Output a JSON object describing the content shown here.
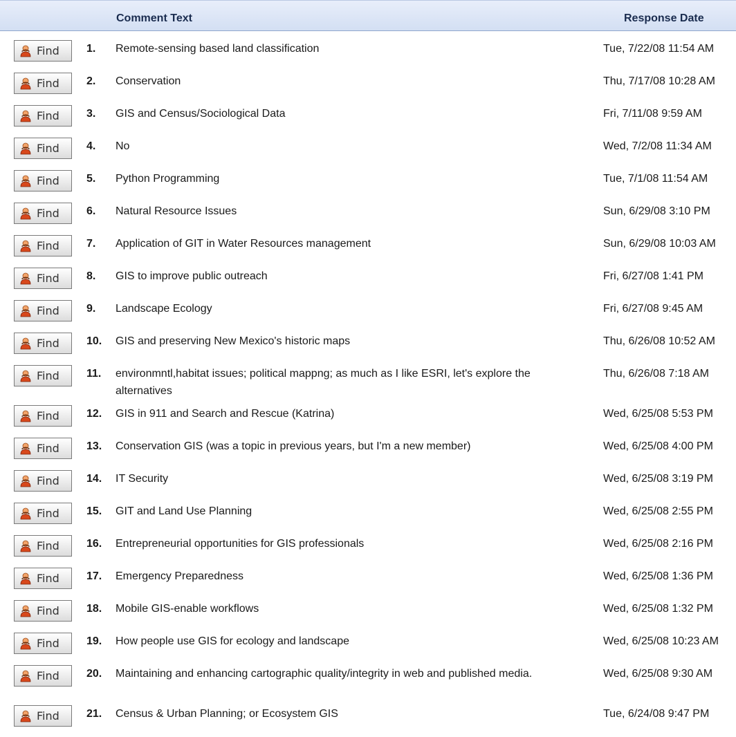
{
  "header": {
    "comment_col": "Comment Text",
    "date_col": "Response Date"
  },
  "find_label": "Find",
  "button_icon": "person-icon",
  "rows": [
    {
      "num": "1.",
      "text": "Remote-sensing based land classification",
      "date": "Tue, 7/22/08 11:54 AM"
    },
    {
      "num": "2.",
      "text": "Conservation",
      "date": "Thu, 7/17/08 10:28 AM"
    },
    {
      "num": "3.",
      "text": "GIS and Census/Sociological Data",
      "date": "Fri, 7/11/08 9:59 AM"
    },
    {
      "num": "4.",
      "text": "No",
      "date": "Wed, 7/2/08 11:34 AM"
    },
    {
      "num": "5.",
      "text": "Python Programming",
      "date": "Tue, 7/1/08 11:54 AM"
    },
    {
      "num": "6.",
      "text": "Natural Resource Issues",
      "date": "Sun, 6/29/08 3:10 PM"
    },
    {
      "num": "7.",
      "text": "Application of GIT in Water Resources management",
      "date": "Sun, 6/29/08 10:03 AM"
    },
    {
      "num": "8.",
      "text": "GIS to improve public outreach",
      "date": "Fri, 6/27/08 1:41 PM"
    },
    {
      "num": "9.",
      "text": "Landscape Ecology",
      "date": "Fri, 6/27/08 9:45 AM"
    },
    {
      "num": "10.",
      "text": "GIS and preserving New Mexico's historic maps",
      "date": "Thu, 6/26/08 10:52 AM"
    },
    {
      "num": "11.",
      "text": "environmntl,habitat issues; political mappng; as much as I like ESRI, let's explore the alternatives",
      "date": "Thu, 6/26/08 7:18 AM"
    },
    {
      "num": "12.",
      "text": "GIS in 911 and Search and Rescue (Katrina)",
      "date": "Wed, 6/25/08 5:53 PM"
    },
    {
      "num": "13.",
      "text": "Conservation GIS (was a topic in previous years, but I'm a new member)",
      "date": "Wed, 6/25/08 4:00 PM"
    },
    {
      "num": "14.",
      "text": "IT Security",
      "date": "Wed, 6/25/08 3:19 PM"
    },
    {
      "num": "15.",
      "text": "GIT and Land Use Planning",
      "date": "Wed, 6/25/08 2:55 PM"
    },
    {
      "num": "16.",
      "text": "Entrepreneurial opportunities for GIS professionals",
      "date": "Wed, 6/25/08 2:16 PM"
    },
    {
      "num": "17.",
      "text": "Emergency Preparedness",
      "date": "Wed, 6/25/08 1:36 PM"
    },
    {
      "num": "18.",
      "text": "Mobile GIS-enable workflows",
      "date": "Wed, 6/25/08 1:32 PM"
    },
    {
      "num": "19.",
      "text": "How people use GIS for ecology and landscape",
      "date": "Wed, 6/25/08 10:23 AM"
    },
    {
      "num": "20.",
      "text": "Maintaining and enhancing cartographic quality/integrity in web and published media.",
      "date": "Wed, 6/25/08 9:30 AM"
    },
    {
      "num": "21.",
      "text": "Census & Urban Planning; or Ecosystem GIS",
      "date": "Tue, 6/24/08 9:47 PM"
    }
  ]
}
